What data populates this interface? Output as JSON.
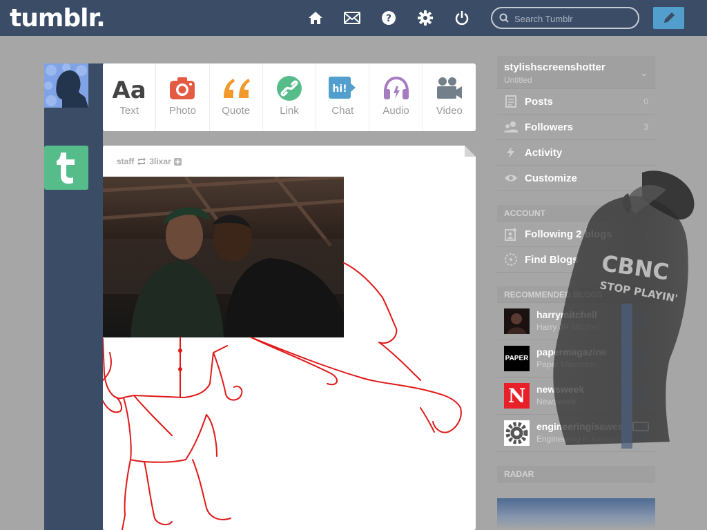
{
  "header": {
    "logo": "tumblr.",
    "search_placeholder": "Search Tumblr"
  },
  "post_types": [
    {
      "label": "Text",
      "icon": "text-icon",
      "color": "#444444"
    },
    {
      "label": "Photo",
      "icon": "camera-icon",
      "color": "#e45b44"
    },
    {
      "label": "Quote",
      "icon": "quote-icon",
      "color": "#f2992e"
    },
    {
      "label": "Link",
      "icon": "link-icon",
      "color": "#56bc8a"
    },
    {
      "label": "Chat",
      "icon": "chat-icon",
      "color": "#529ecc"
    },
    {
      "label": "Audio",
      "icon": "headphones-icon",
      "color": "#a77dc2"
    },
    {
      "label": "Video",
      "icon": "video-camera-icon",
      "color": "#748089"
    }
  ],
  "post": {
    "author": "staff",
    "reblogged_from": "3lixar"
  },
  "sidebar": {
    "blog_name": "stylishscreenshotter",
    "blog_title": "Untitled",
    "items": [
      {
        "label": "Posts",
        "count": "0",
        "icon": "posts-icon"
      },
      {
        "label": "Followers",
        "count": "3",
        "icon": "followers-icon"
      },
      {
        "label": "Activity",
        "count": "",
        "icon": "activity-icon"
      },
      {
        "label": "Customize",
        "count": "",
        "icon": "eye-icon"
      }
    ],
    "account_header": "ACCOUNT",
    "account_items": [
      {
        "label": "Following 2 blogs",
        "icon": "following-icon"
      },
      {
        "label": "Find Blogs",
        "icon": "compass-icon"
      }
    ],
    "recommended_header": "RECOMMENDED BLOGS",
    "recommended": [
      {
        "name": "harrymitchell",
        "desc": "Harry JR Mitchell",
        "avatar_color": "#1a1110"
      },
      {
        "name": "papermagazine",
        "desc": "Paper Magazine",
        "avatar_color": "#000000",
        "avatar_text": "PAPER"
      },
      {
        "name": "newsweek",
        "desc": "Newsweek",
        "avatar_color": "#e8202a",
        "avatar_text": "N"
      },
      {
        "name": "engineeringisawes",
        "desc": "Engineering is Awesome",
        "avatar_color": "#ffffff"
      }
    ],
    "radar_header": "RADAR"
  },
  "overlay": {
    "shirt_text_1": "CBNC",
    "shirt_text_2": "STOP PLAYIN'"
  }
}
